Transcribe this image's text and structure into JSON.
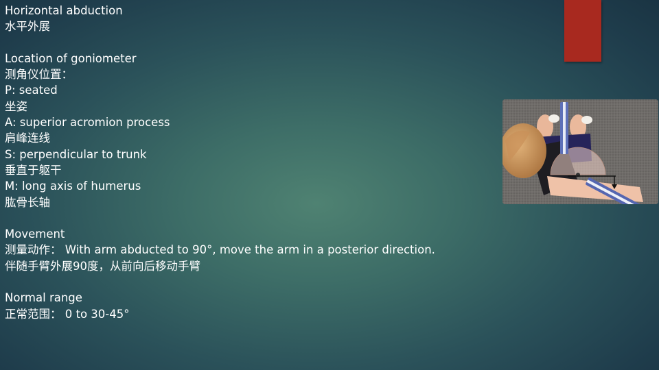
{
  "slide": {
    "accent_color": "#a8291f",
    "lines": [
      "Horizontal abduction",
      "水平外展",
      "",
      "Location of goniometer",
      "测角仪位置：",
      "P: seated",
      "坐姿",
      "A: superior acromion process",
      "肩峰连线",
      "S: perpendicular to trunk",
      "垂直于躯干",
      "M: long axis of humerus",
      "肱骨长轴",
      "",
      "Movement",
      "测量动作： With arm abducted to 90°, move the arm in a posterior direction.",
      "伴随手臂外展90度，从前向后移动手臂",
      "",
      "Normal range",
      "正常范围： 0 to 30-45°"
    ]
  },
  "photo": {
    "description_icon": "goniometer-photo"
  }
}
